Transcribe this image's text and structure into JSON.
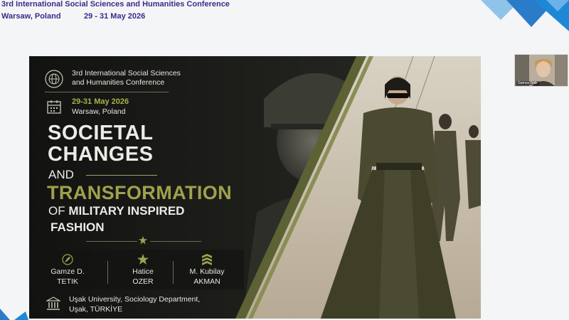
{
  "header": {
    "title": "3rd International Social Sciences and Humanities Conference",
    "location": "Warsaw, Poland",
    "dates": "29 - 31 May 2026"
  },
  "slide": {
    "conference_name_line1": "3rd International Social Sciences",
    "conference_name_line2": "and Humanities Conference",
    "date": "29-31 May 2026",
    "location": "Warsaw, Poland",
    "title_line1": "SOCIETAL",
    "title_line2": "CHANGES",
    "title_and": "AND",
    "title_transformation": "TRANSFORMATION",
    "title_of": "OF",
    "title_military": "MILITARY INSPIRED",
    "title_fashion": "FASHION",
    "authors": [
      {
        "first": "Gamze D.",
        "last": "TETIK",
        "icon": "feather-icon"
      },
      {
        "first": "Hatice",
        "last": "OZER",
        "icon": "star-icon"
      },
      {
        "first": "M. Kubilay",
        "last": "AKMAN",
        "icon": "chevron-badge-icon"
      }
    ],
    "university_line1": "Uşak University, Sociology Department,",
    "university_line2": "Uşak, TÜRKİYE",
    "accent_color": "#9ea24c"
  },
  "participant": {
    "name": "Gamze Tetik"
  },
  "colors": {
    "header_text": "#3b2a8c",
    "corner_decor": "#1e88d6"
  }
}
